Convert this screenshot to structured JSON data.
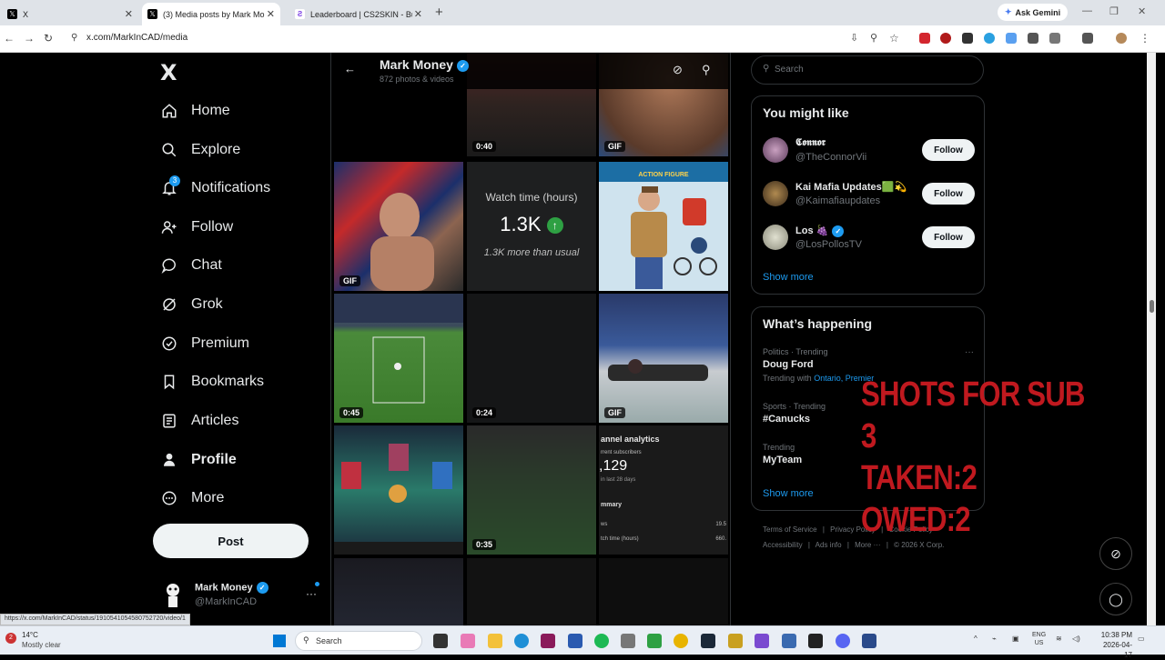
{
  "browser": {
    "tabs": [
      {
        "label": "X",
        "icon": "x-logo-icon",
        "active": false
      },
      {
        "label": "(3) Media posts by Mark Mone",
        "icon": "x-logo-icon",
        "active": true
      },
      {
        "label": "Leaderboard | CS2SKIN - Built",
        "icon": "cs2skin-icon",
        "active": false
      }
    ],
    "gemini_label": "Ask Gemini",
    "url": "x.com/MarkInCAD/media",
    "status_url": "https://x.com/MarkInCAD/status/1910541054580752720/video/1"
  },
  "nav": {
    "logo": "X",
    "items": [
      {
        "label": "Home",
        "icon": "home-icon"
      },
      {
        "label": "Explore",
        "icon": "search-icon"
      },
      {
        "label": "Notifications",
        "icon": "bell-icon",
        "badge": "3"
      },
      {
        "label": "Follow",
        "icon": "add-person-icon"
      },
      {
        "label": "Chat",
        "icon": "chat-icon"
      },
      {
        "label": "Grok",
        "icon": "grok-icon"
      },
      {
        "label": "Premium",
        "icon": "verified-icon"
      },
      {
        "label": "Bookmarks",
        "icon": "bookmark-icon"
      },
      {
        "label": "Articles",
        "icon": "article-icon"
      },
      {
        "label": "Profile",
        "icon": "person-icon"
      },
      {
        "label": "More",
        "icon": "more-circle-icon"
      }
    ],
    "post_label": "Post",
    "account": {
      "name": "Mark Money",
      "handle": "@MarkInCAD"
    }
  },
  "profile": {
    "name": "Mark Money",
    "count": "872 photos & videos"
  },
  "media": {
    "row0": [
      "",
      "0:40",
      "GIF"
    ],
    "watch_card": {
      "title": "Watch time (hours)",
      "value": "1.3K",
      "sub": "1.3K more than usual"
    },
    "action_figure_label": "ACTION FIGURE",
    "badges": {
      "r1c0": "GIF",
      "r2c0": "0:45",
      "r2c1": "0:24",
      "r2c2": "GIF",
      "r3c1": "0:35"
    },
    "analytics": {
      "title": "annel analytics",
      "sub": "rrent subscribers",
      "num": ",129",
      "days": "in last 28 days",
      "summary": "mmary",
      "row1": "ws",
      "row2": "tch time (hours)",
      "v1": "19.5",
      "v2": "660."
    }
  },
  "right": {
    "search_placeholder": "Search",
    "wtf_title": "You might like",
    "wtf": [
      {
        "name": "𝕮𝖔𝖓𝖓𝖔𝖗",
        "handle": "@TheConnorVii",
        "button": "Follow"
      },
      {
        "name": "Kai Mafia Updates🟩💫",
        "handle": "@Kaimafiaupdates",
        "button": "Follow"
      },
      {
        "name": "Los 🍇",
        "handle": "@LosPollosTV",
        "button": "Follow"
      }
    ],
    "show_more": "Show more",
    "happening_title": "What’s happening",
    "trends": [
      {
        "context": "Politics · Trending",
        "title": "Doug Ford",
        "with_label": "Trending with",
        "with": "Ontario, Premier"
      },
      {
        "context": "Sports · Trending",
        "title": "#Canucks"
      },
      {
        "context": "Trending",
        "title": "MyTeam"
      }
    ],
    "footer": [
      "Terms of Service",
      "Privacy Policy",
      "Cookie Policy",
      "Accessibility",
      "Ads info",
      "More ···",
      "© 2026 X Corp."
    ]
  },
  "overlay": {
    "line1": "SHOTS FOR SUB 3",
    "line2": "TAKEN:2",
    "line3": "OWED:2"
  },
  "taskbar": {
    "temp": "14°C",
    "condition": "Mostly clear",
    "weather_badge": "2",
    "search_placeholder": "Search",
    "lang1": "ENG",
    "lang2": "US",
    "time": "10:38 PM",
    "date": "2026-04-17"
  }
}
